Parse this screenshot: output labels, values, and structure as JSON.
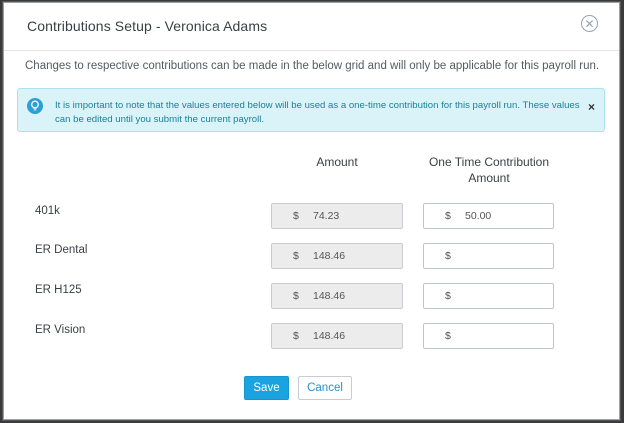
{
  "dialog": {
    "title": "Contributions Setup - Veronica Adams",
    "close_glyph": "✕",
    "subtitle": "Changes to respective contributions can be made in the below grid and will only be applicable for this payroll run."
  },
  "alert": {
    "icon": "lightbulb-icon",
    "text": "It is important to note that the values entered below will be used as a one-time contribution for this payroll run. These values can be edited until you submit the current payroll.",
    "close_glyph": "×",
    "colors": {
      "background": "#d9f3f8",
      "text": "#1c7f97",
      "icon": "#2a9fd8"
    }
  },
  "grid": {
    "headers": {
      "amount": "Amount",
      "one_time": "One Time Contribution Amount"
    },
    "rows": [
      {
        "label": "401k",
        "currency": "$",
        "amount": "74.23",
        "one_time_currency": "$",
        "one_time_value": "50.00"
      },
      {
        "label": "ER Dental",
        "currency": "$",
        "amount": "148.46",
        "one_time_currency": "$",
        "one_time_value": ""
      },
      {
        "label": "ER H125",
        "currency": "$",
        "amount": "148.46",
        "one_time_currency": "$",
        "one_time_value": ""
      },
      {
        "label": "ER Vision",
        "currency": "$",
        "amount": "148.46",
        "one_time_currency": "$",
        "one_time_value": ""
      }
    ]
  },
  "footer": {
    "save_label": "Save",
    "cancel_label": "Cancel",
    "colors": {
      "primary": "#1aa3e0",
      "link": "#2a8fce"
    }
  }
}
